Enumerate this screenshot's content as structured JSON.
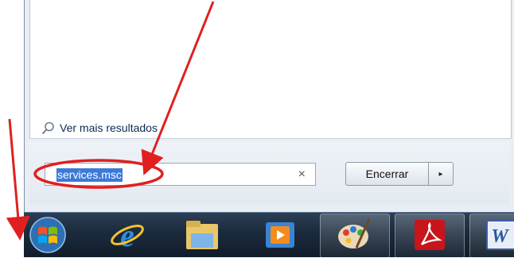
{
  "start_menu": {
    "see_more_results": "Ver mais resultados",
    "search": {
      "value": "services.msc",
      "clear_symbol": "×"
    },
    "shutdown": {
      "label": "Encerrar",
      "arrow_symbol": "▸"
    }
  },
  "taskbar": {
    "items": [
      {
        "icon": "windows-start-orb"
      },
      {
        "icon": "internet-explorer-icon"
      },
      {
        "icon": "file-explorer-icon"
      },
      {
        "icon": "media-player-icon"
      },
      {
        "icon": "paint-icon"
      },
      {
        "icon": "adobe-reader-icon"
      },
      {
        "icon": "word-icon"
      }
    ]
  },
  "colors": {
    "annotation": "#e02020",
    "selection": "#3d7ad6",
    "taskbar": "#1b2a3c"
  }
}
